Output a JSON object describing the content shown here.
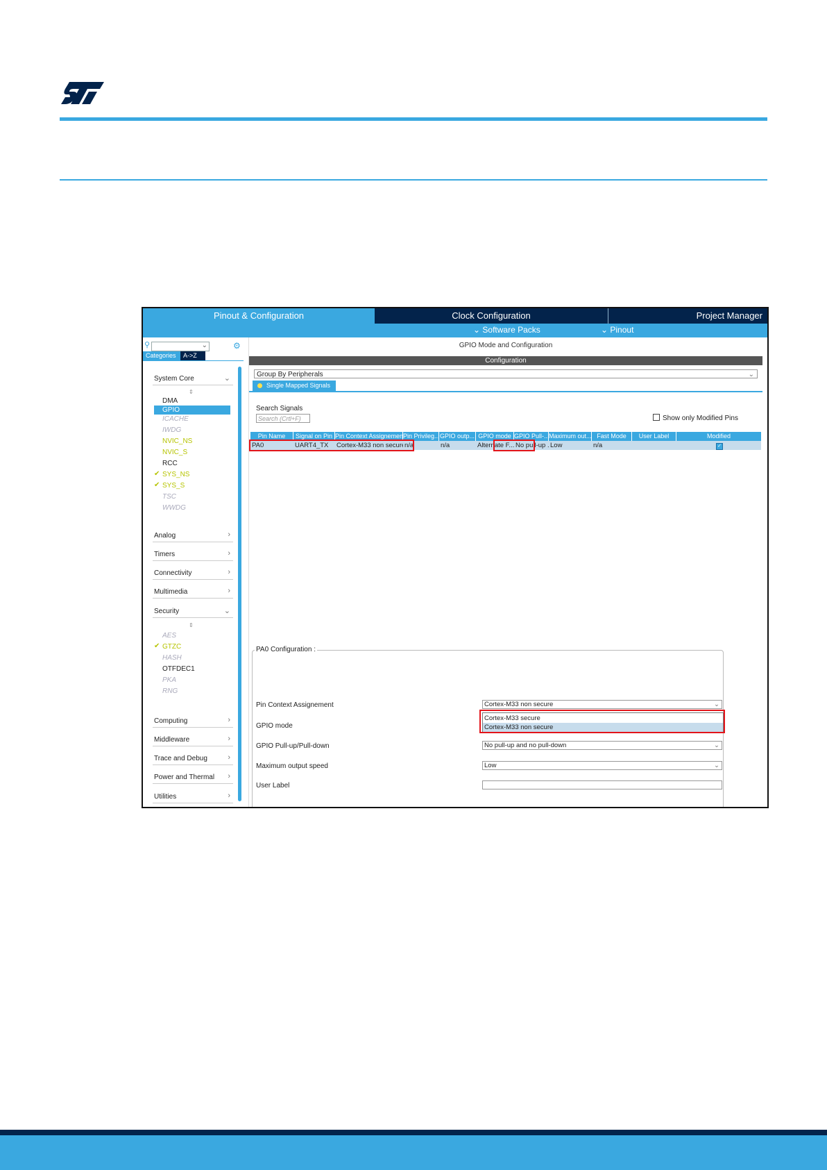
{
  "brand": {
    "accent": "#3aa8e0",
    "dark": "#03234b",
    "alert": "#e3141a"
  },
  "tabs": {
    "pinout_config": "Pinout & Configuration",
    "clock_config": "Clock Configuration",
    "project_manager": "Project Manager"
  },
  "subbar": {
    "software_packs": "Software Packs",
    "pinout": "Pinout"
  },
  "left_panel": {
    "categories_tab": "Categories",
    "az_tab": "A->Z",
    "groups": {
      "system_core": "System Core",
      "analog": "Analog",
      "timers": "Timers",
      "connectivity": "Connectivity",
      "multimedia": "Multimedia",
      "security": "Security",
      "computing": "Computing",
      "middleware": "Middleware",
      "trace_debug": "Trace and Debug",
      "power_thermal": "Power and Thermal",
      "utilities": "Utilities"
    },
    "system_core_items": [
      "DMA",
      "GPIO",
      "ICACHE",
      "IWDG",
      "NVIC_NS",
      "NVIC_S",
      "RCC",
      "SYS_NS",
      "SYS_S",
      "TSC",
      "WWDG"
    ],
    "security_items": [
      "AES",
      "GTZC",
      "HASH",
      "OTFDEC1",
      "PKA",
      "RNG"
    ]
  },
  "right_panel": {
    "title": "GPIO Mode and Configuration",
    "configuration": "Configuration",
    "group_by": "Group By Peripherals",
    "signals_tab": "Single Mapped Signals",
    "search_label": "Search Signals",
    "search_placeholder": "Search (Crtl+F)",
    "show_modified": "Show only Modified Pins",
    "table": {
      "headers": [
        "Pin Name",
        "Signal on Pin",
        "Pin Context Assignement",
        "Pin Privileg...",
        "GPIO outp...",
        "GPIO mode",
        "GPIO Pull-...",
        "Maximum out...",
        "Fast Mode",
        "User Label",
        "Modified"
      ],
      "row": [
        "PA0",
        "UART4_TX",
        "Cortex-M33 non secure",
        "n/a",
        "n/a",
        "Alternate F...",
        "No pull-up ...",
        "Low",
        "n/a",
        "",
        "✓"
      ]
    },
    "pa0_config": {
      "title": "PA0 Configuration :",
      "pin_context_label": "Pin Context Assignement",
      "pin_context_value": "Cortex-M33 non secure",
      "dropdown_options": [
        "Cortex-M33 secure",
        "Cortex-M33 non secure"
      ],
      "gpio_mode_label": "GPIO mode",
      "pull_label": "GPIO Pull-up/Pull-down",
      "pull_value": "No pull-up and no pull-down",
      "speed_label": "Maximum output speed",
      "speed_value": "Low",
      "user_label": "User Label"
    }
  }
}
